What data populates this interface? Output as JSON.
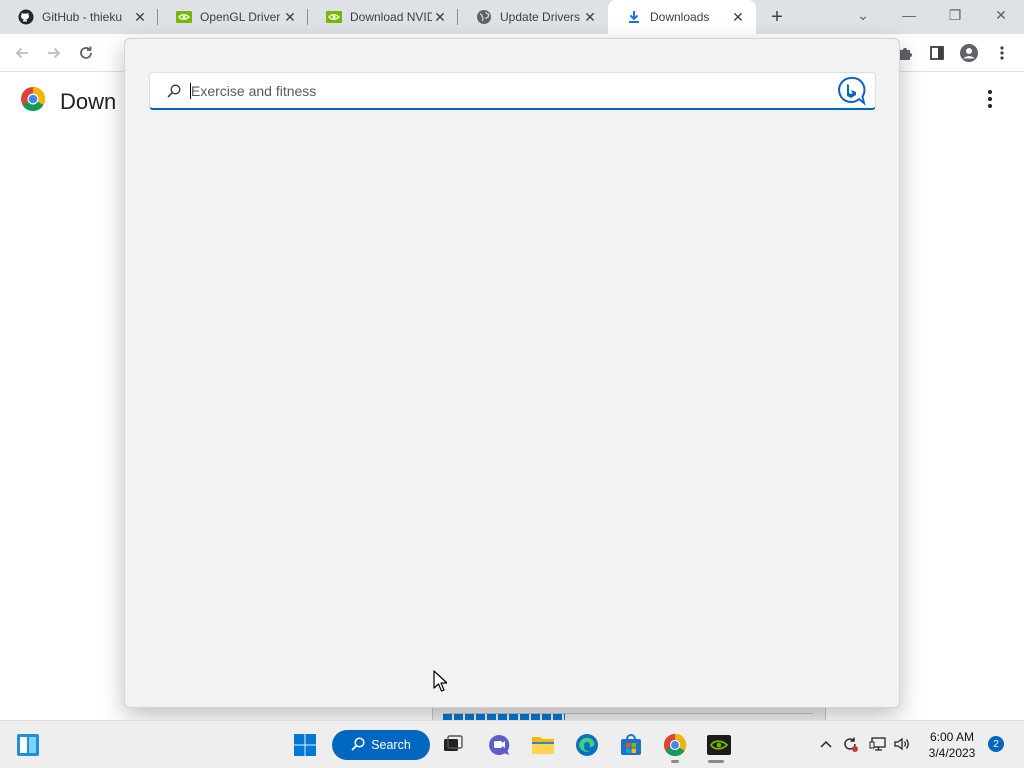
{
  "browser": {
    "tabs": [
      {
        "title": "GitHub - thieku",
        "favicon": "github-icon"
      },
      {
        "title": "OpenGL Driver",
        "favicon": "nvidia-icon"
      },
      {
        "title": "Download NVID",
        "favicon": "nvidia-icon"
      },
      {
        "title": "Update Drivers",
        "favicon": "globe-icon"
      },
      {
        "title": "Downloads",
        "favicon": "download-icon",
        "active": true
      }
    ],
    "new_tab_label": "+",
    "window_controls": {
      "minimize": "—",
      "restore": "❐",
      "close": "✕",
      "tab_search": "⌄"
    }
  },
  "page": {
    "title": "Downloads",
    "visible_title": "Down"
  },
  "search_flyout": {
    "placeholder": "Exercise and fitness",
    "value": "",
    "search_icon": "search-icon",
    "bing_icon": "bing-chat-icon"
  },
  "taskbar": {
    "search_label": "Search",
    "apps": [
      "windows-start-icon",
      "task-view-icon",
      "teams-chat-icon",
      "file-explorer-icon",
      "edge-icon",
      "store-icon",
      "chrome-icon",
      "nvidia-icon"
    ],
    "clock_time": "6:00 AM",
    "clock_date": "3/4/2023",
    "notification_count": "2"
  },
  "colors": {
    "accent": "#0067c0",
    "tabstrip": "#dee1e6",
    "flyout_bg": "#f2f2f2"
  }
}
